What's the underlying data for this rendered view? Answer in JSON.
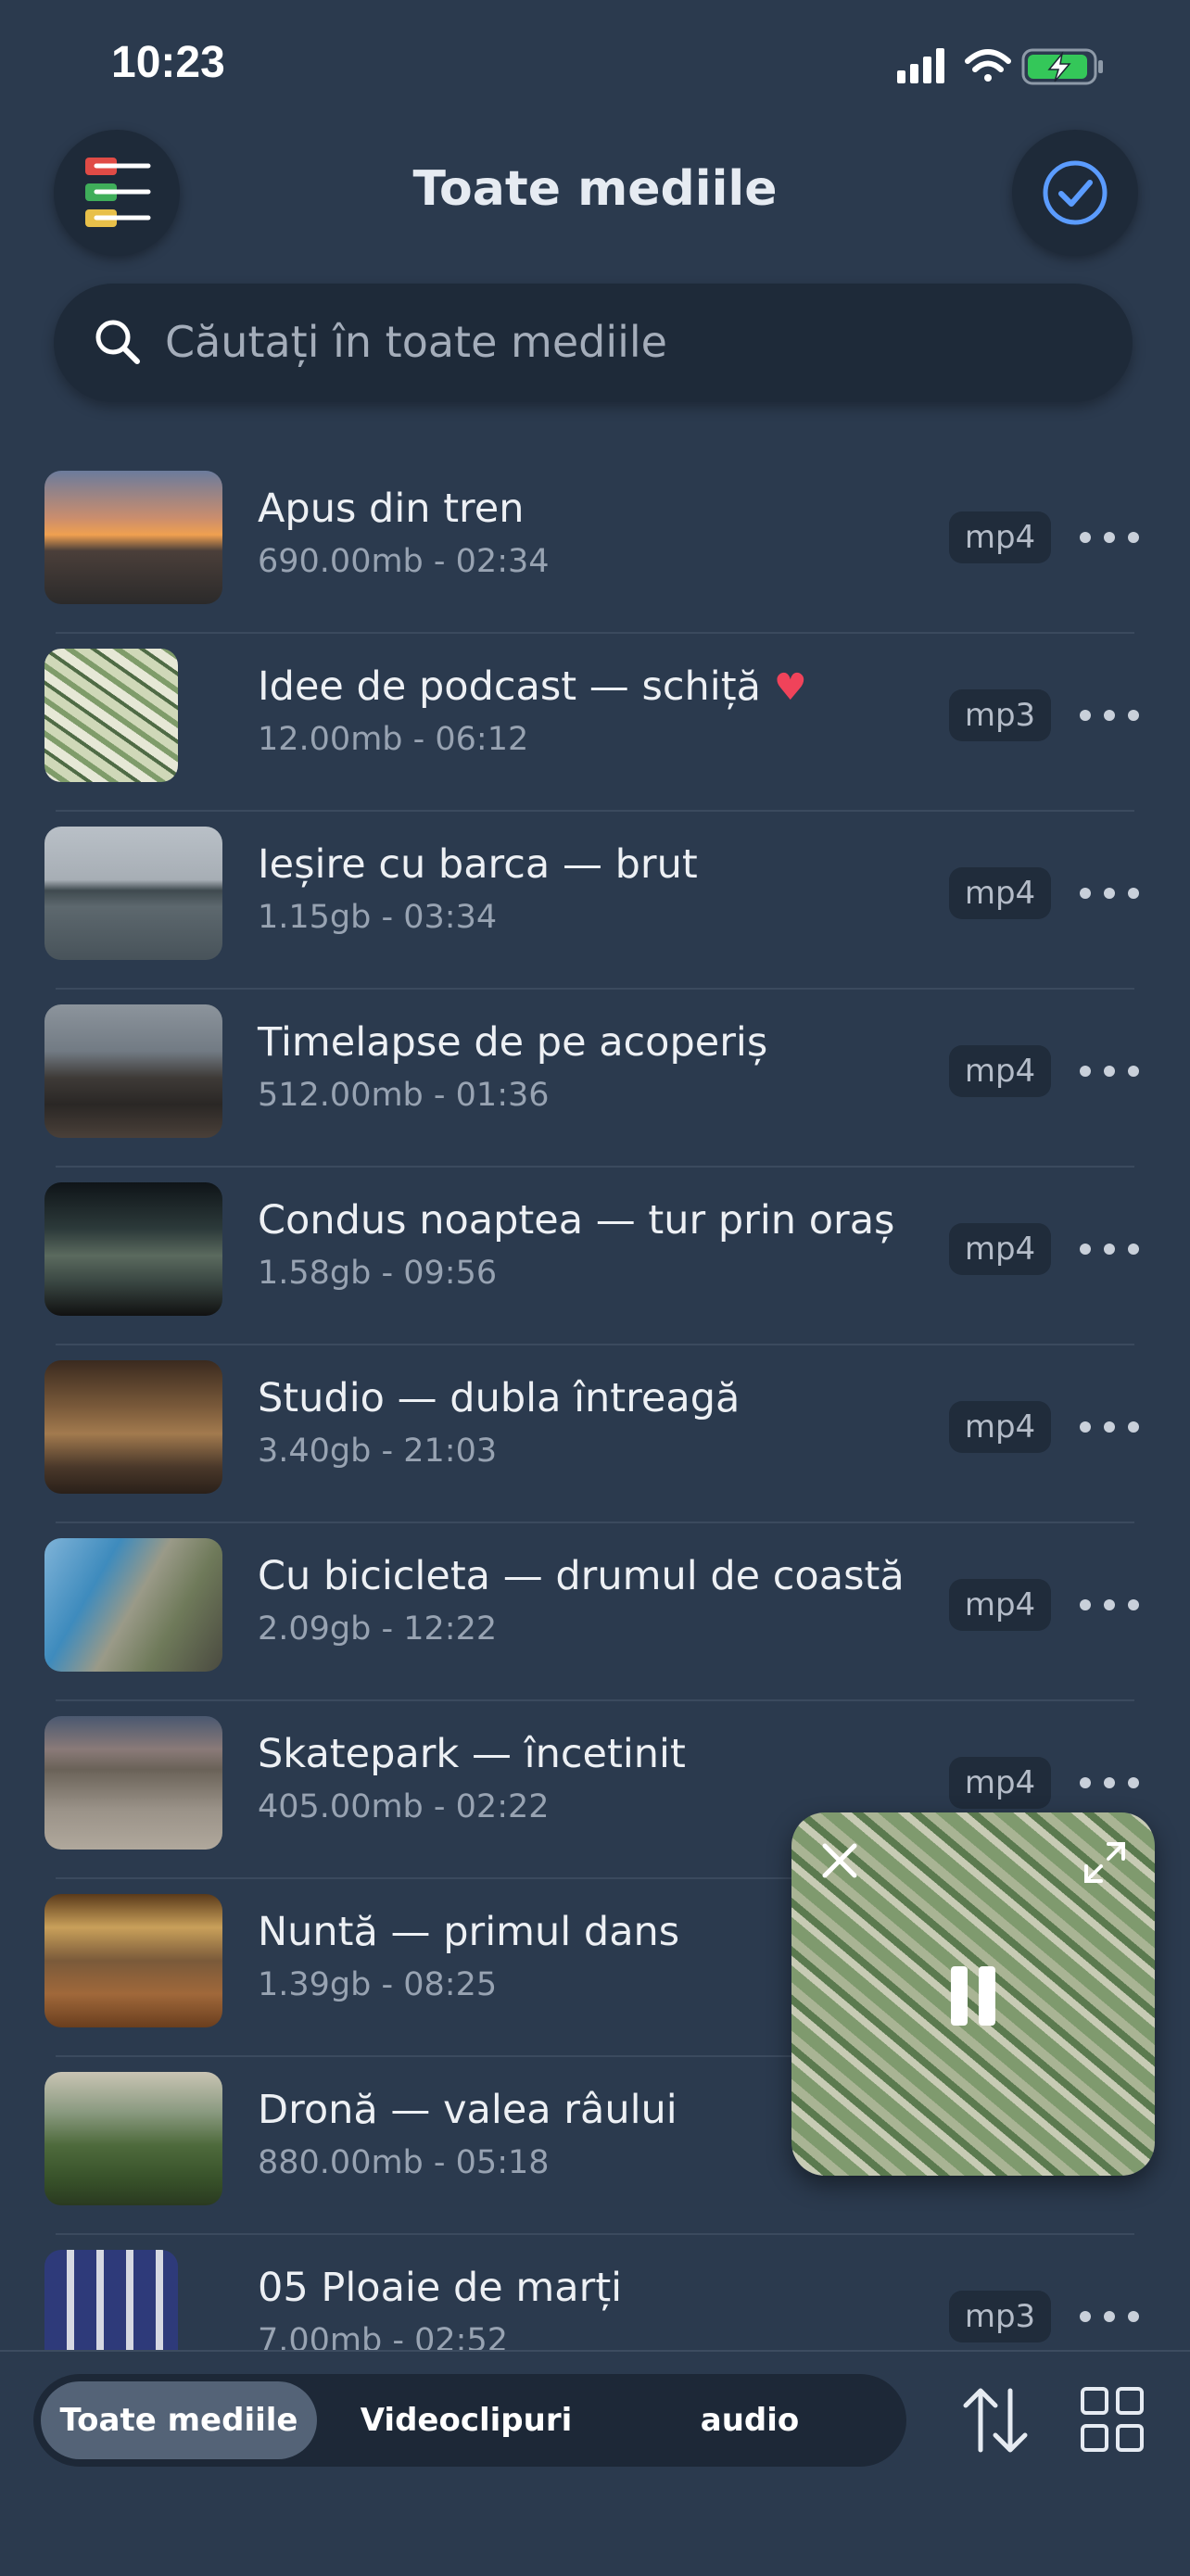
{
  "status": {
    "time": "10:23"
  },
  "header": {
    "title": "Toate mediile"
  },
  "search": {
    "placeholder": "Căutați în toate mediile"
  },
  "items": [
    {
      "title": "Apus din tren",
      "meta": "690.00mb - 02:34",
      "format": "mp4",
      "favorite": false
    },
    {
      "title": "Idee de podcast — schiță",
      "meta": "12.00mb - 06:12",
      "format": "mp3",
      "favorite": true
    },
    {
      "title": "Ieșire cu barca — brut",
      "meta": "1.15gb - 03:34",
      "format": "mp4",
      "favorite": false
    },
    {
      "title": "Timelapse de pe acoperiș",
      "meta": "512.00mb - 01:36",
      "format": "mp4",
      "favorite": false
    },
    {
      "title": "Condus noaptea — tur prin oraș",
      "meta": "1.58gb - 09:56",
      "format": "mp4",
      "favorite": false
    },
    {
      "title": "Studio — dubla întreagă",
      "meta": "3.40gb - 21:03",
      "format": "mp4",
      "favorite": false
    },
    {
      "title": "Cu bicicleta — drumul de coastă",
      "meta": "2.09gb - 12:22",
      "format": "mp4",
      "favorite": false
    },
    {
      "title": "Skatepark — încetinit",
      "meta": "405.00mb - 02:22",
      "format": "mp4",
      "favorite": false
    },
    {
      "title": "Nuntă — primul dans",
      "meta": "1.39gb - 08:25",
      "format": "",
      "favorite": false
    },
    {
      "title": "Dronă — valea râului",
      "meta": "880.00mb - 05:18",
      "format": "",
      "favorite": false
    },
    {
      "title": "05 Ploaie de marți",
      "meta": "7.00mb - 02:52",
      "format": "mp3",
      "favorite": false
    }
  ],
  "tabs": {
    "all": "Toate mediile",
    "videos": "Videoclipuri",
    "audio": "audio",
    "active": "all"
  },
  "colors": {
    "background": "#2b3a4e",
    "accent": "#5b9cff",
    "heart": "#f0435a",
    "battery": "#34c759"
  }
}
